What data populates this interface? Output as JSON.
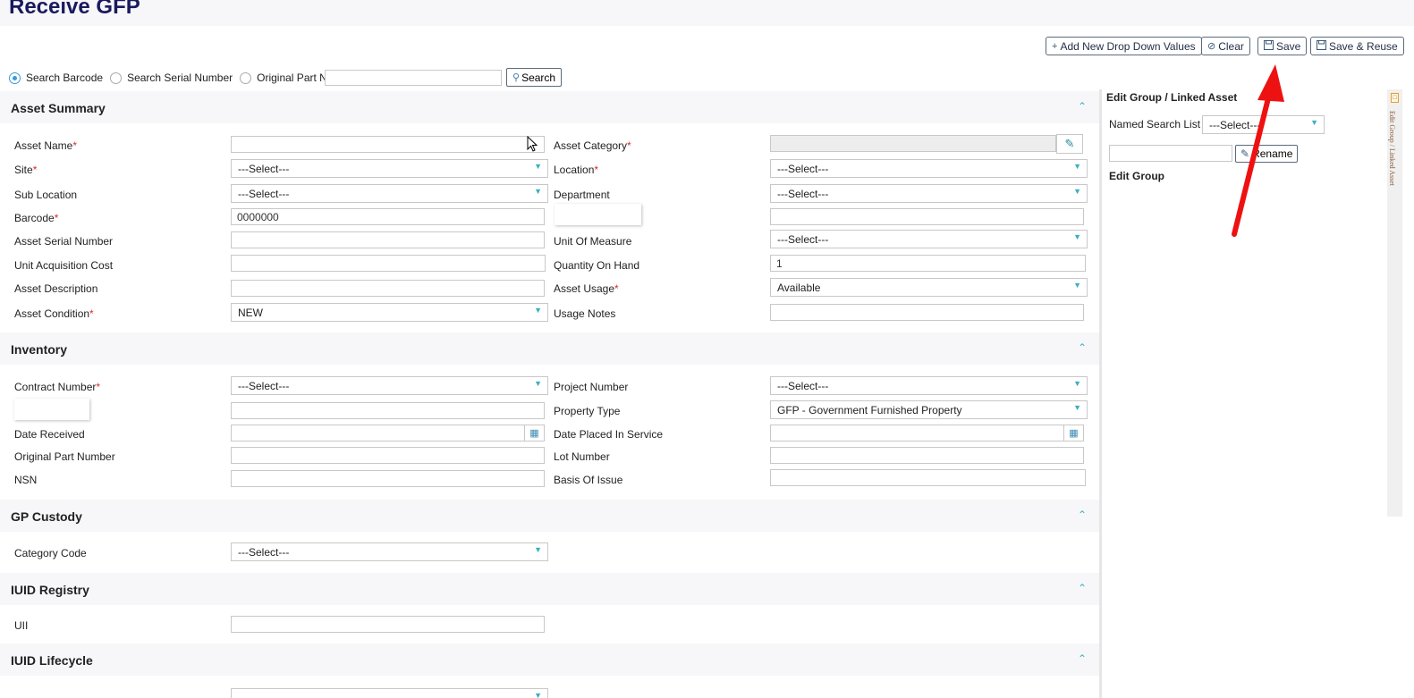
{
  "page": {
    "title": "Receive GFP"
  },
  "toolbar": {
    "add_new": "Add New Drop Down Values",
    "clear": "Clear",
    "save": "Save",
    "save_reuse": "Save & Reuse"
  },
  "search": {
    "options": [
      "Search Barcode",
      "Search Serial Number",
      "Original Part No"
    ],
    "selected": "Search Barcode",
    "value": "",
    "button": "Search"
  },
  "sections": {
    "asset_summary": "Asset Summary",
    "inventory": "Inventory",
    "gp_custody": "GP Custody",
    "iuid_registry": "IUID Registry",
    "iuid_lifecycle": "IUID Lifecycle"
  },
  "asset_summary": {
    "asset_name": {
      "label": "Asset Name",
      "value": ""
    },
    "asset_category": {
      "label": "Asset Category",
      "value": ""
    },
    "site": {
      "label": "Site",
      "value": "---Select---"
    },
    "location": {
      "label": "Location",
      "value": "---Select---"
    },
    "sub_location": {
      "label": "Sub Location",
      "value": "---Select---"
    },
    "department": {
      "label": "Department",
      "value": "---Select---"
    },
    "barcode": {
      "label": "Barcode",
      "value": "0000000"
    },
    "asset_serial_number": {
      "label": "Asset Serial Number",
      "value": ""
    },
    "unit_of_measure": {
      "label": "Unit Of Measure",
      "value": "---Select---"
    },
    "unit_acquisition_cost": {
      "label": "Unit Acquisition Cost",
      "value": ""
    },
    "quantity_on_hand": {
      "label": "Quantity On Hand",
      "value": "1"
    },
    "asset_description": {
      "label": "Asset Description",
      "value": ""
    },
    "asset_usage": {
      "label": "Asset Usage",
      "value": "Available"
    },
    "asset_condition": {
      "label": "Asset Condition",
      "value": "NEW"
    },
    "usage_notes": {
      "label": "Usage Notes",
      "value": ""
    }
  },
  "inventory": {
    "contract_number": {
      "label": "Contract Number",
      "value": "---Select---"
    },
    "project_number": {
      "label": "Project Number",
      "value": "---Select---"
    },
    "property_type": {
      "label": "Property Type",
      "value": "GFP - Government Furnished Property"
    },
    "date_received": {
      "label": "Date Received",
      "value": ""
    },
    "date_placed_in_service": {
      "label": "Date Placed In Service",
      "value": ""
    },
    "original_part_number": {
      "label": "Original Part Number",
      "value": ""
    },
    "lot_number": {
      "label": "Lot Number",
      "value": ""
    },
    "nsn": {
      "label": "NSN",
      "value": ""
    },
    "basis_of_issue": {
      "label": "Basis Of Issue",
      "value": ""
    }
  },
  "gp_custody": {
    "category_code": {
      "label": "Category Code",
      "value": "---Select---"
    }
  },
  "iuid_registry": {
    "uii": {
      "label": "UII",
      "value": ""
    }
  },
  "right_panel": {
    "title": "Edit Group / Linked Asset",
    "named_search_label": "Named Search List :",
    "named_search_value": "---Select---",
    "rename_button": "Rename",
    "edit_group": "Edit Group",
    "vertical_tab": "Edit Group / Linked Asset"
  },
  "colors": {
    "accent": "#3ab0c0",
    "title": "#1a1a5e",
    "required": "#d03030",
    "arrow": "#ee1111"
  }
}
